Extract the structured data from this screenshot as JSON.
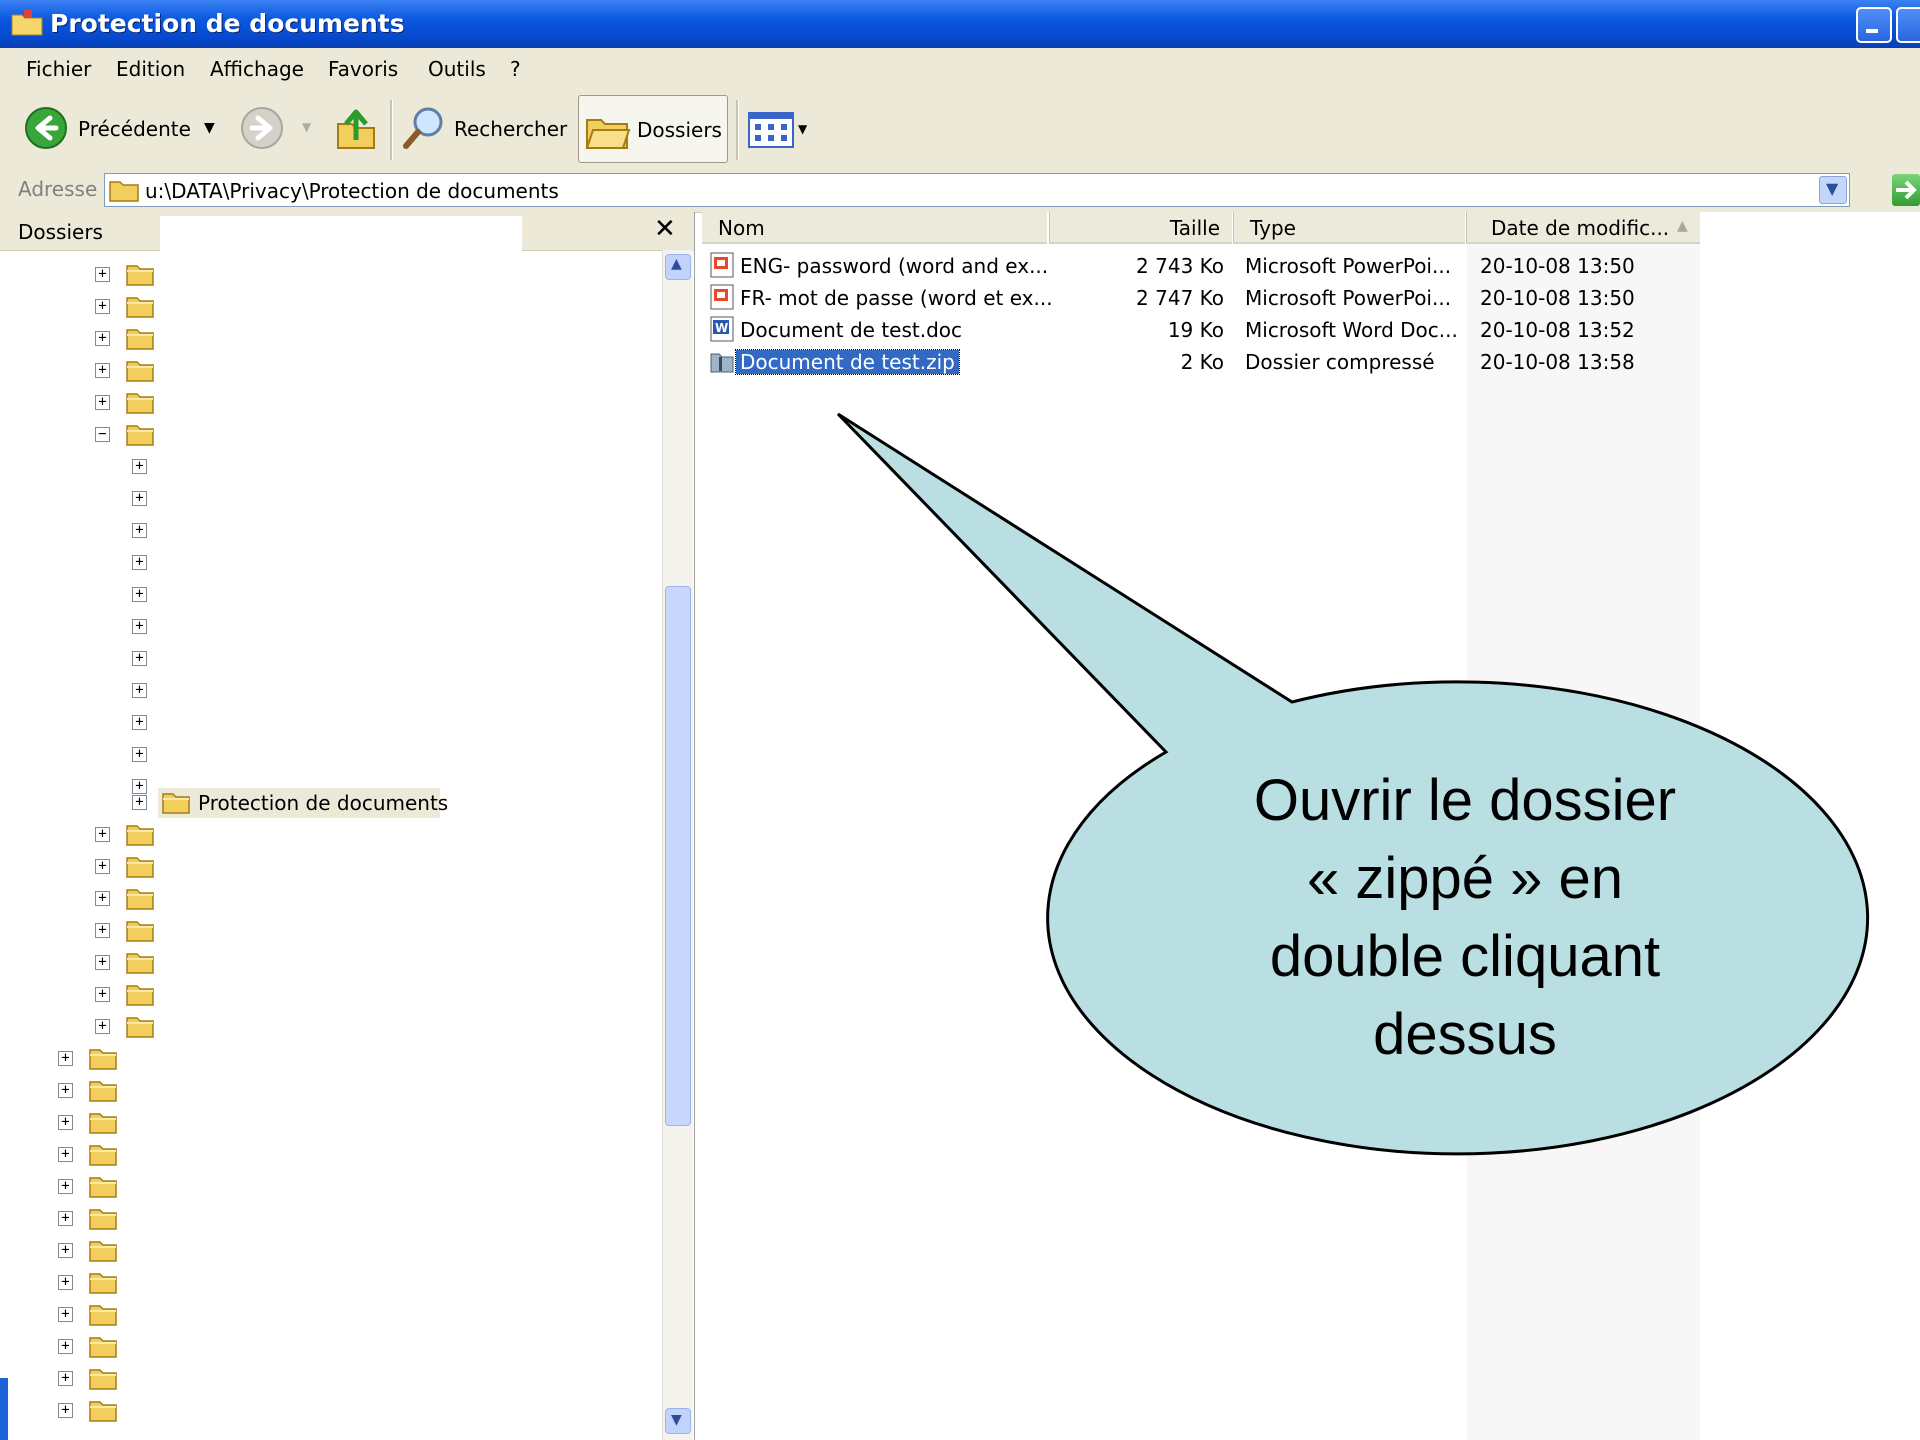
{
  "window": {
    "title": "Protection de documents"
  },
  "menu": {
    "items": [
      "Fichier",
      "Edition",
      "Affichage",
      "Favoris",
      "Outils",
      "?"
    ]
  },
  "toolbar": {
    "back_label": "Précédente",
    "search_label": "Rechercher",
    "folders_label": "Dossiers"
  },
  "address": {
    "label": "Adresse",
    "value": "u:\\DATA\\Privacy\\Protection de documents"
  },
  "folders_pane": {
    "title": "Dossiers",
    "close_glyph": "✕",
    "selected_label": "Protection de documents"
  },
  "files": {
    "columns": [
      "Nom",
      "Taille",
      "Type",
      "Date de modific..."
    ],
    "rows": [
      {
        "name": "ENG- password (word and ex...",
        "size": "2 743 Ko",
        "type": "Microsoft PowerPoi...",
        "date": "20-10-08 13:50",
        "icon": "powerpoint-icon"
      },
      {
        "name": "FR- mot de passe (word et ex...",
        "size": "2 747 Ko",
        "type": "Microsoft PowerPoi...",
        "date": "20-10-08 13:50",
        "icon": "powerpoint-icon"
      },
      {
        "name": "Document de test.doc",
        "size": "19 Ko",
        "type": "Microsoft Word Doc...",
        "date": "20-10-08 13:52",
        "icon": "word-icon"
      },
      {
        "name": "Document de test.zip",
        "size": "2 Ko",
        "type": "Dossier compressé",
        "date": "20-10-08 13:58",
        "icon": "zip-folder-icon",
        "selected": true
      }
    ]
  },
  "callout": {
    "lines": [
      "Ouvrir le dossier",
      "« zippé » en",
      "double cliquant",
      "dessus"
    ],
    "fill": "#b9dfe2"
  },
  "colors": {
    "titlebar": "#0a58e0",
    "chrome": "#ece9d8",
    "selection": "#316ac5"
  }
}
